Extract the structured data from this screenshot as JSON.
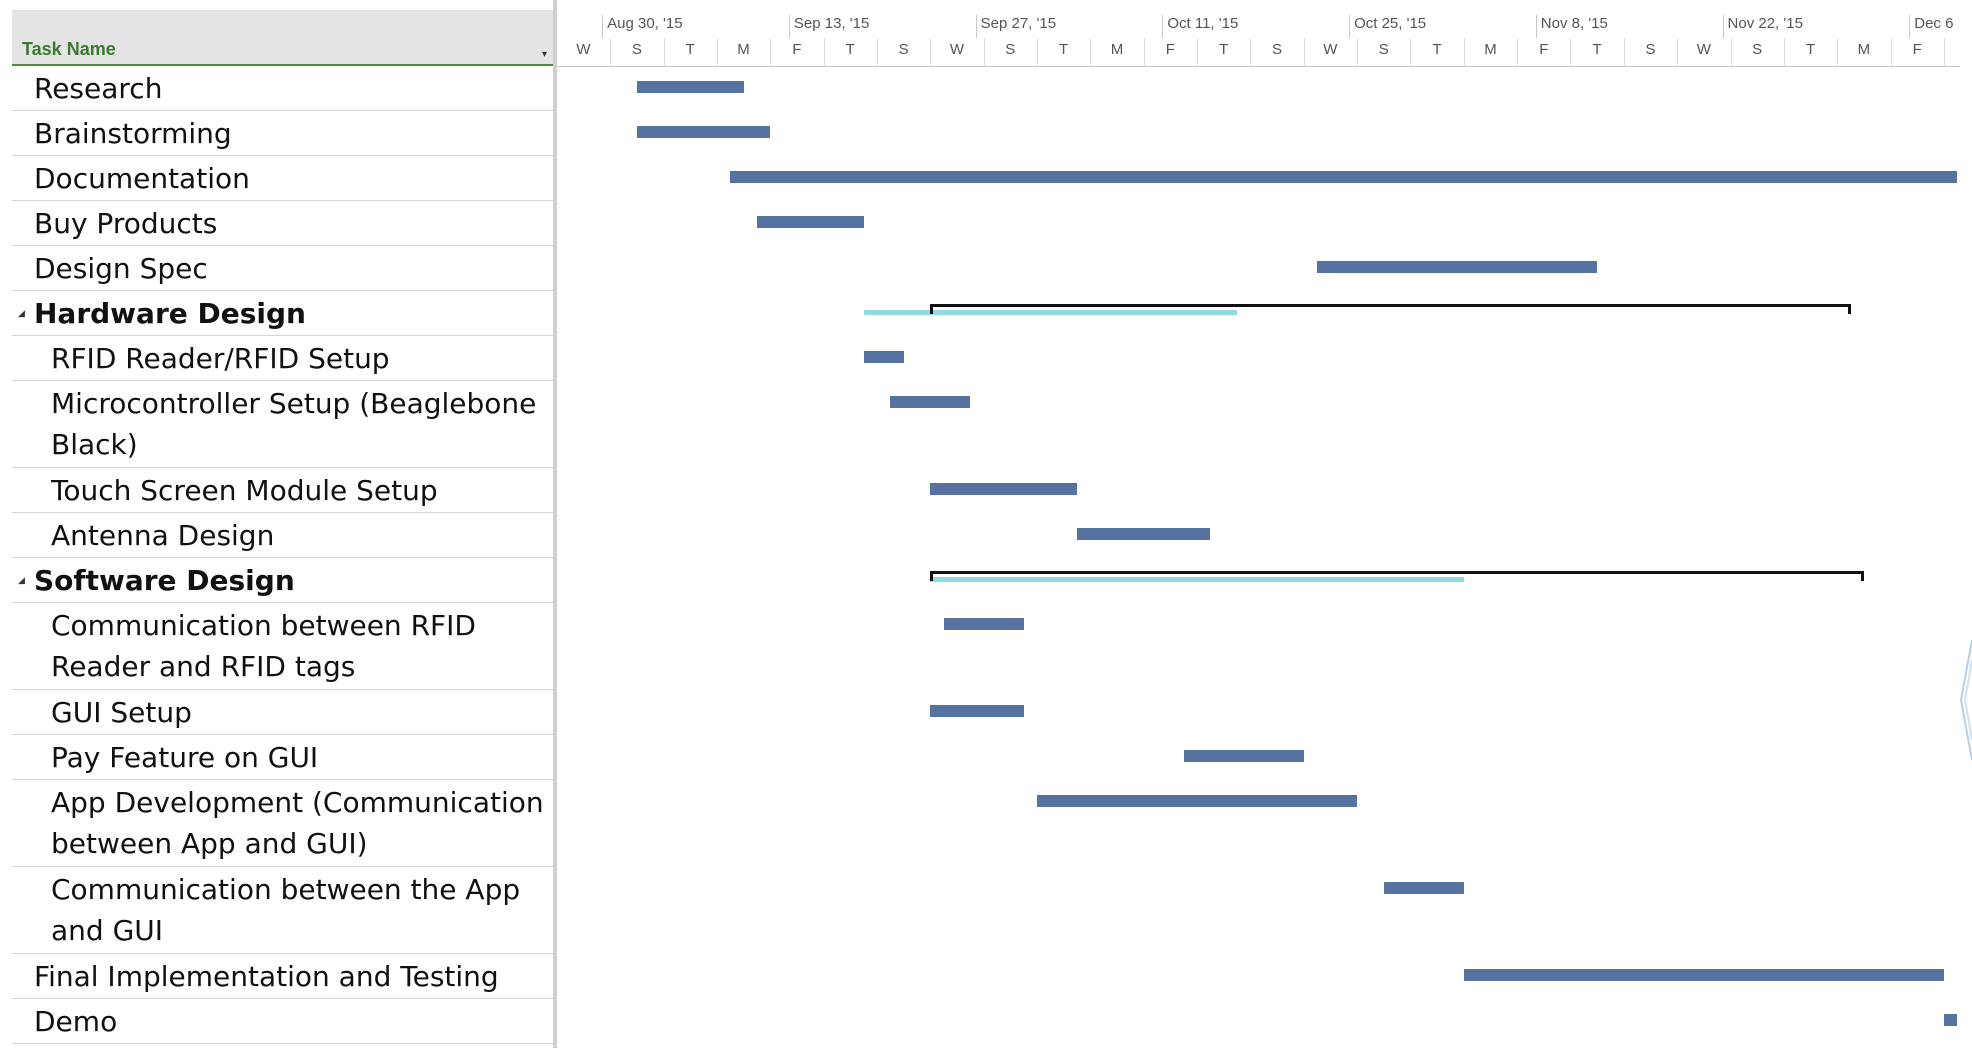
{
  "table": {
    "header_label": "Task Name",
    "header_dropdown_icon": "dropdown-arrow-icon",
    "tasks": [
      {
        "name": "Research",
        "level": 0,
        "summary": false
      },
      {
        "name": "Brainstorming",
        "level": 0,
        "summary": false
      },
      {
        "name": "Documentation",
        "level": 0,
        "summary": false
      },
      {
        "name": "Buy Products",
        "level": 0,
        "summary": false
      },
      {
        "name": "Design Spec",
        "level": 0,
        "summary": false
      },
      {
        "name": "Hardware Design",
        "level": 0,
        "summary": true
      },
      {
        "name": "RFID Reader/RFID Setup",
        "level": 1,
        "summary": false
      },
      {
        "name": "Microcontroller Setup (Beaglebone",
        "name_line2": "Black)",
        "level": 1,
        "summary": false
      },
      {
        "name": "Touch Screen Module Setup",
        "level": 1,
        "summary": false
      },
      {
        "name": "Antenna Design",
        "level": 1,
        "summary": false
      },
      {
        "name": "Software Design",
        "level": 0,
        "summary": true
      },
      {
        "name": "Communication between RFID",
        "name_line2": "Reader and RFID tags",
        "level": 1,
        "summary": false
      },
      {
        "name": "GUI Setup",
        "level": 1,
        "summary": false
      },
      {
        "name": "Pay Feature on GUI",
        "level": 1,
        "summary": false
      },
      {
        "name": "App Development (Communication",
        "name_line2": "between App and GUI)",
        "level": 1,
        "summary": false
      },
      {
        "name": "Communication between the App",
        "name_line2": "and GUI",
        "level": 1,
        "summary": false
      },
      {
        "name": "Final Implementation and Testing",
        "level": 0,
        "summary": false
      },
      {
        "name": "Demo",
        "level": 0,
        "summary": false
      }
    ]
  },
  "timescale": {
    "weeks": [
      "Aug 30, '15",
      "Sep 13, '15",
      "Sep 27, '15",
      "Oct 11, '15",
      "Oct 25, '15",
      "Nov 8, '15",
      "Nov 22, '15",
      "Dec 6"
    ],
    "days": [
      "W",
      "S",
      "T",
      "M",
      "F",
      "T",
      "S",
      "W",
      "S",
      "T",
      "M",
      "F",
      "T",
      "S",
      "W",
      "S",
      "T",
      "M",
      "F",
      "T",
      "S",
      "W",
      "S",
      "T",
      "M",
      "F"
    ]
  },
  "schedule": {
    "_unit": "day offsets along the timescale; the W column under Aug 30 is day 0",
    "tasks": [
      {
        "start": 1.5,
        "end": 3.5
      },
      {
        "start": 1.5,
        "end": 4.0
      },
      {
        "start": 3.25,
        "end": 26.25
      },
      {
        "start": 3.75,
        "end": 5.75
      },
      {
        "start": 14.25,
        "end": 19.5
      },
      {
        "start": 7.0,
        "end": 24.25,
        "progress_start": 5.75,
        "progress_end": 12.75
      },
      {
        "start": 5.75,
        "end": 6.5
      },
      {
        "start": 6.25,
        "end": 7.75
      },
      {
        "start": 7.0,
        "end": 9.75
      },
      {
        "start": 9.75,
        "end": 12.25
      },
      {
        "start": 7.0,
        "end": 24.5,
        "progress_start": 7.0,
        "progress_end": 17.0
      },
      {
        "start": 7.25,
        "end": 8.75
      },
      {
        "start": 7.0,
        "end": 8.75
      },
      {
        "start": 11.75,
        "end": 14.0
      },
      {
        "start": 9.0,
        "end": 15.0
      },
      {
        "start": 15.5,
        "end": 17.0
      },
      {
        "start": 17.0,
        "end": 26.0
      },
      {
        "start": 26.0,
        "end": 26.25
      }
    ]
  },
  "colors": {
    "task_bar": "#5572a0",
    "progress": "#8fdce0",
    "summary": "#111111",
    "header_text": "#3a7a2f"
  }
}
